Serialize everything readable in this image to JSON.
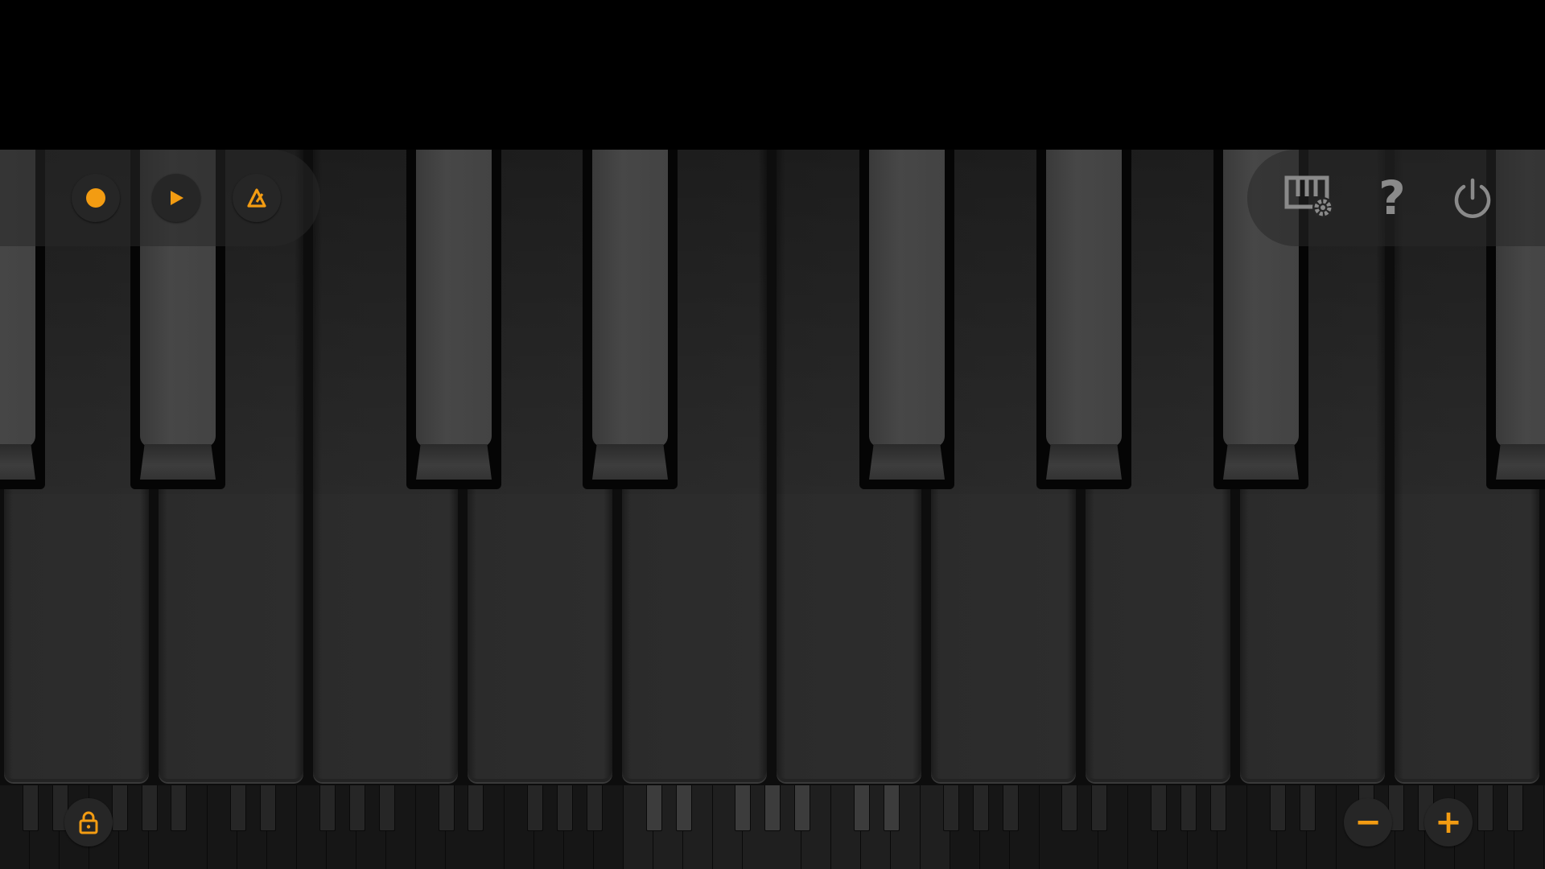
{
  "app": {
    "name": "piano-keyboard-app"
  },
  "colors": {
    "accent": "#f39c12",
    "icon_gray": "#8a8a8a",
    "background": "#000000"
  },
  "toolbar_left": {
    "buttons": [
      {
        "name": "record-button",
        "icon": "record-dot-icon"
      },
      {
        "name": "play-button",
        "icon": "play-triangle-icon"
      },
      {
        "name": "metronome-button",
        "icon": "metronome-icon"
      }
    ]
  },
  "toolbar_right": {
    "buttons": [
      {
        "name": "keyboard-settings-button",
        "icon": "keyboard-gear-icon"
      },
      {
        "name": "help-button",
        "icon": "question-mark-icon",
        "label": "?"
      },
      {
        "name": "power-button",
        "icon": "power-icon"
      }
    ]
  },
  "keyboard": {
    "visible_white_keys": 10,
    "visible_black_keys": 7
  },
  "mini_keyboard": {
    "lock_icon": "lock-icon",
    "zoom_out_label": "−",
    "zoom_in_label": "+"
  }
}
